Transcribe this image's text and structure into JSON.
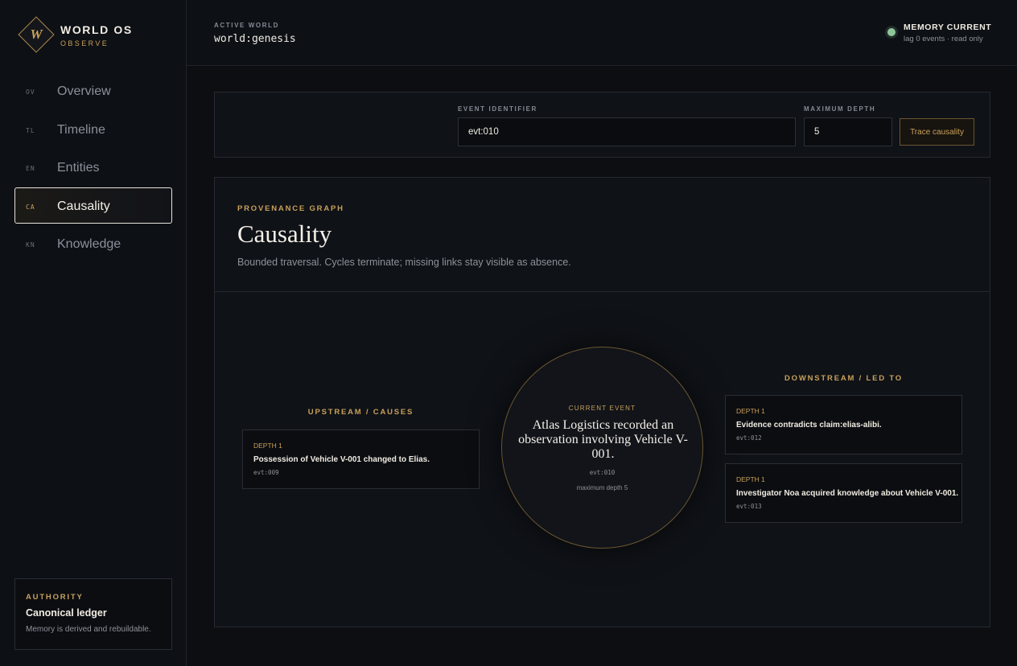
{
  "brand": {
    "mark": "W",
    "title": "WORLD OS",
    "subtitle": "OBSERVE"
  },
  "nav": [
    {
      "code": "OV",
      "label": "Overview",
      "active": false
    },
    {
      "code": "TL",
      "label": "Timeline",
      "active": false
    },
    {
      "code": "EN",
      "label": "Entities",
      "active": false
    },
    {
      "code": "CA",
      "label": "Causality",
      "active": true
    },
    {
      "code": "KN",
      "label": "Knowledge",
      "active": false
    }
  ],
  "authority": {
    "kicker": "AUTHORITY",
    "title": "Canonical ledger",
    "description": "Memory is derived and rebuildable."
  },
  "topbar": {
    "active_world_label": "ACTIVE WORLD",
    "active_world_value": "world:genesis",
    "memory_title": "MEMORY CURRENT",
    "memory_subtitle": "lag 0 events · read only",
    "status_color": "#8ec69a"
  },
  "search": {
    "event_label": "EVENT IDENTIFIER",
    "event_value": "evt:010",
    "depth_label": "MAXIMUM DEPTH",
    "depth_value": "5",
    "button_label": "Trace causality"
  },
  "graph": {
    "kicker": "PROVENANCE GRAPH",
    "title": "Causality",
    "description": "Bounded traversal. Cycles terminate; missing links stay visible as absence.",
    "upstream_heading": "UPSTREAM / CAUSES",
    "downstream_heading": "DOWNSTREAM / LED TO",
    "upstream": [
      {
        "depth": "DEPTH 1",
        "text": "Possession of Vehicle V-001 changed to Elias.",
        "id": "evt:009"
      }
    ],
    "downstream": [
      {
        "depth": "DEPTH 1",
        "text": "Evidence contradicts claim:elias-alibi.",
        "id": "evt:012"
      },
      {
        "depth": "DEPTH 1",
        "text": "Investigator Noa acquired knowledge about Vehicle V-001.",
        "id": "evt:013"
      }
    ],
    "current": {
      "kicker": "CURRENT EVENT",
      "text": "Atlas Logistics recorded an observation involving Vehicle V-001.",
      "id": "evt:010",
      "depth": "maximum depth 5"
    }
  },
  "colors": {
    "accent": "#c9a05a",
    "background": "#0c0e12",
    "panel": "#0f1217"
  }
}
